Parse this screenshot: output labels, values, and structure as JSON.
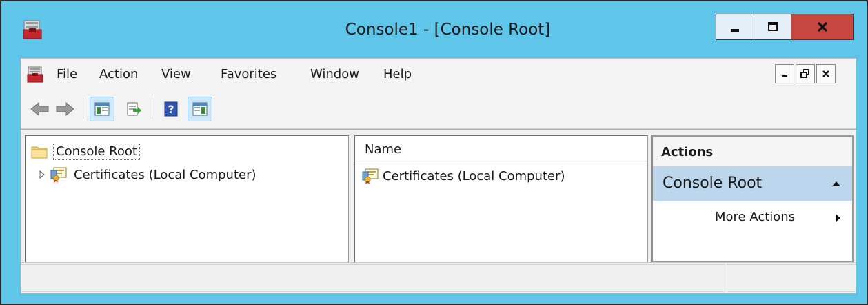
{
  "window": {
    "title": "Console1 - [Console Root]"
  },
  "title_controls": {
    "minimize": "minimize-icon",
    "maximize": "maximize-icon",
    "close": "close-icon"
  },
  "menu": {
    "items": [
      "File",
      "Action",
      "View",
      "Favorites",
      "Window",
      "Help"
    ],
    "mdi_controls": [
      "minimize-icon",
      "restore-icon",
      "close-icon"
    ]
  },
  "toolbar": {
    "buttons": [
      "back-arrow-icon",
      "forward-arrow-icon",
      "show-hide-console-tree-icon",
      "export-list-icon",
      "help-icon",
      "show-hide-action-pane-icon"
    ]
  },
  "tree": {
    "root": "Console Root",
    "children": [
      "Certificates (Local Computer)"
    ]
  },
  "list": {
    "column_header": "Name",
    "items": [
      "Certificates (Local Computer)"
    ]
  },
  "actions": {
    "header": "Actions",
    "section": "Console Root",
    "items": [
      "More Actions"
    ]
  },
  "colors": {
    "frame": "#5fc5e9",
    "close_button": "#c6473f",
    "actions_section": "#bcd6ee",
    "toolbar_active": "#cde8fa"
  }
}
